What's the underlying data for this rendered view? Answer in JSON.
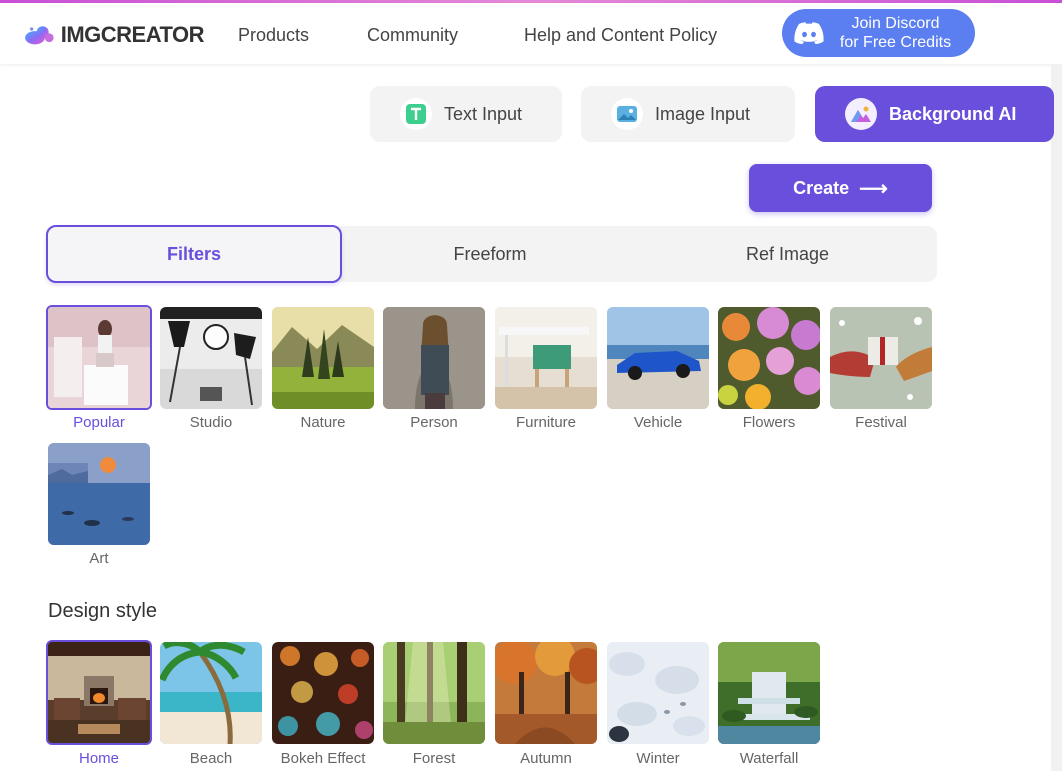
{
  "header": {
    "logo_text": "IMGCREATOR",
    "nav": [
      "Products",
      "Community",
      "Help and Content Policy"
    ],
    "discord_line1": "Join Discord",
    "discord_line2": "for Free Credits"
  },
  "modes": [
    {
      "label": "Text Input",
      "icon": "text-input-icon"
    },
    {
      "label": "Image Input",
      "icon": "image-input-icon"
    },
    {
      "label": "Background AI",
      "icon": "background-ai-icon",
      "active": true
    }
  ],
  "create_label": "Create",
  "tabs": [
    "Filters",
    "Freeform",
    "Ref Image"
  ],
  "filters": [
    {
      "label": "Popular",
      "selected": true
    },
    {
      "label": "Studio"
    },
    {
      "label": "Nature"
    },
    {
      "label": "Person"
    },
    {
      "label": "Furniture"
    },
    {
      "label": "Vehicle"
    },
    {
      "label": "Flowers"
    },
    {
      "label": "Festival"
    },
    {
      "label": "Art"
    }
  ],
  "design_style_title": "Design style",
  "styles": [
    {
      "label": "Home",
      "selected": true
    },
    {
      "label": "Beach"
    },
    {
      "label": "Bokeh Effect"
    },
    {
      "label": "Forest"
    },
    {
      "label": "Autumn"
    },
    {
      "label": "Winter"
    },
    {
      "label": "Waterfall"
    }
  ],
  "colors": {
    "accent": "#6a4fdc",
    "discord": "#5b7ff0"
  }
}
